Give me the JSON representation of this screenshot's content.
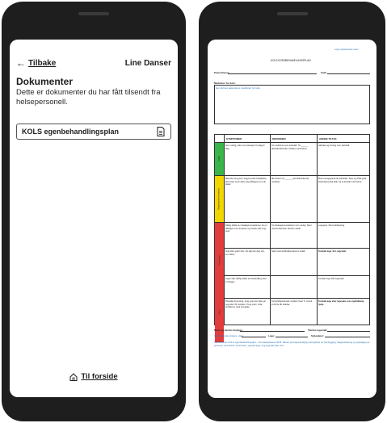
{
  "left_screen": {
    "back_label": "Tilbake",
    "user_name": "Line Danser",
    "title": "Dokumenter",
    "description": "Dette er dokumenter du har fått tilsendt fra helsepersonell.",
    "document_button_label": "KOLS egenbehandlingsplan",
    "home_link_label": "Til forside"
  },
  "document": {
    "logo_text": "Logo sykehusets navn",
    "title": "KOLS EGENBEHANDLINGSPLAN",
    "patient_label": "Pasientnavn:",
    "born_label": "Født:",
    "meds_label": "Medisiner for kols:",
    "meds_hint": "Her skrives pasientens medisiner for kols.",
    "table_headers": [
      "SYMPTOMER",
      "MEDISINER",
      "ANDRE TILTAK"
    ],
    "zone_labels": [
      "Stabil",
      "Begynnende forverring",
      "Forverring",
      "Akutt"
    ],
    "rows": [
      [
        "Som vanlig, eller noe variasjon fra dag til dag.",
        "Ta medisiner som anbefalt. Ta ______ (korttidsvirkende medisin) ved behov.",
        "Aktivitet og trening som anbefalt."
      ],
      [
        "Økende tung pust, begynnende forkjølelse, økt hoste og du føler deg dårligere enn du pleier.",
        "Øk bruken av ______ (korttidsvirkende medisin).",
        "Bruk energisparende teknikker. Spis og drikk godt. Hold deg fysisk aktiv og ta kontakt ved behov."
      ],
      [
        "Dårlig effekt av inhalasjonsmedisiner. Du er dårligere enn du pleier og merker økt tung pust.",
        "Ta inhalasjonsmedisiner som vanlig. Start med kortisonkur dersom avtalt.",
        "Lepepust. Slimmobilisering."
      ],
      [
        "Gult eller grønt slim. Du kjenner deg syk, evt. feber.",
        "Start med antibiotika dersom avtalt.",
        "Kontakt lege. Evt. legevakt."
      ],
      [
        "Ingen eller dårlig effekt av behandling etter 2-3 dager.",
        "",
        "Kontakt lege eller legevakt."
      ],
      [
        "Plutselig forverring, tung pust som ikke gir seg etter 30 minutter. Tung pust i hvile, problemer med å snakke.",
        "Ta korttidsvirkende medisin hvert 5. minutt inntil du får lettelse.",
        "Kontakt lege eller legevakt som øyeblikkelig hjelp."
      ]
    ],
    "footer_name_label": "Navn og telefon fastlege:",
    "footer_phone_label": "Telefon legevakt:",
    "footer_clinic_label": "Utarbeidende instans, dato:",
    "footer_doctor_label": "Lege:",
    "footer_nurse_label": "Sykepleier:",
    "footer_note": "Standardmal: KOLS egenbehandlingsplan - Kunnskapsbasert 2015. Basert på nasjonal faglig retningslinje for forebygging, diagnostisering og oppfølging av personer med KOLS. Ved behov: oppsøk lege, ring legevakt eller 113."
  }
}
